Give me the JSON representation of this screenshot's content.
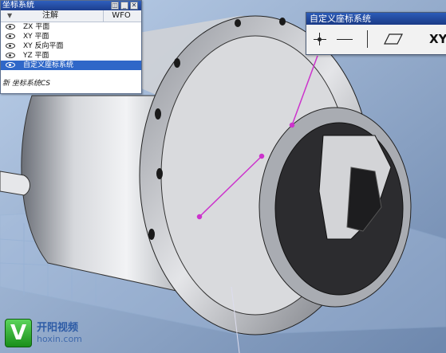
{
  "app": {
    "viewport_background": "#8fa7c6",
    "accent": "#2f67c8",
    "curve_color": "#cc33cc"
  },
  "cs_panel": {
    "title": "坐标系统",
    "controls": [
      "restore",
      "minimize",
      "close"
    ],
    "columns": {
      "note": "注解",
      "wfo": "WFO"
    },
    "rows": [
      {
        "icon": "eye-icon",
        "label": "ZX 平面",
        "selected": false
      },
      {
        "icon": "eye-icon",
        "label": "XY 平面",
        "selected": false
      },
      {
        "icon": "eye-icon",
        "label": "XY 反向平面",
        "selected": false
      },
      {
        "icon": "eye-icon",
        "label": "YZ 平面",
        "selected": false
      },
      {
        "icon": "eye-icon",
        "label": "自定义座标系统",
        "selected": true
      }
    ],
    "footer": "新 坐标系统CS"
  },
  "custom_toolbar": {
    "title": "自定义座标系统",
    "tools": [
      {
        "icon": "point-crosshair-icon"
      },
      {
        "icon": "line-icon"
      },
      {
        "icon": "plane-icon"
      },
      {
        "icon": "xy-label",
        "label": "XY"
      }
    ]
  },
  "logo": {
    "mark": "V",
    "name_cn": "开阳视频",
    "name_en": "hoxin.com"
  }
}
